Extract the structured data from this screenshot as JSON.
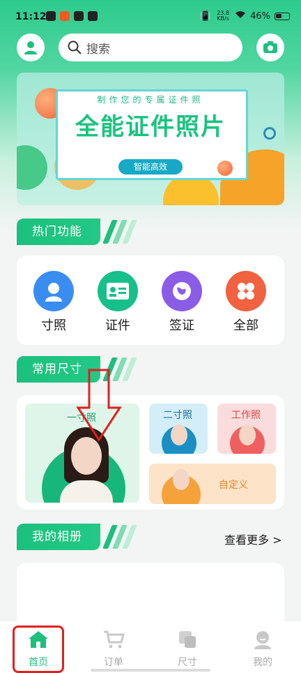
{
  "status_bar": {
    "time": "11:12",
    "speed_value": "23.8",
    "speed_unit": "KB/s",
    "battery": "46%"
  },
  "header": {
    "search_placeholder": "搜索",
    "avatar_icon": "user-icon",
    "camera_icon": "camera-icon"
  },
  "banner": {
    "subtitle": "制作您的专属证件照",
    "title": "全能证件照片",
    "pill": "智能高效"
  },
  "hot_functions": {
    "title": "热门功能",
    "items": [
      {
        "label": "寸照",
        "icon": "portrait-icon",
        "color": "#3a8df0"
      },
      {
        "label": "证件",
        "icon": "id-card-icon",
        "color": "#17c08a"
      },
      {
        "label": "签证",
        "icon": "globe-icon",
        "color": "#8b5ce6"
      },
      {
        "label": "全部",
        "icon": "grid-icon",
        "color": "#f06240"
      }
    ]
  },
  "common_sizes": {
    "title": "常用尺寸",
    "items": [
      {
        "label": "一寸照"
      },
      {
        "label": "二寸照"
      },
      {
        "label": "工作照"
      },
      {
        "label": "自定义"
      }
    ]
  },
  "album": {
    "title": "我的相册",
    "more": "查看更多 >"
  },
  "tab_bar": {
    "items": [
      {
        "label": "首页",
        "icon": "home-icon",
        "active": true
      },
      {
        "label": "订单",
        "icon": "cart-icon",
        "active": false
      },
      {
        "label": "尺寸",
        "icon": "size-icon",
        "active": false
      },
      {
        "label": "我的",
        "icon": "profile-icon",
        "active": false
      }
    ]
  },
  "colors": {
    "accent": "#1dbf7d",
    "highlight": "#e02020"
  }
}
